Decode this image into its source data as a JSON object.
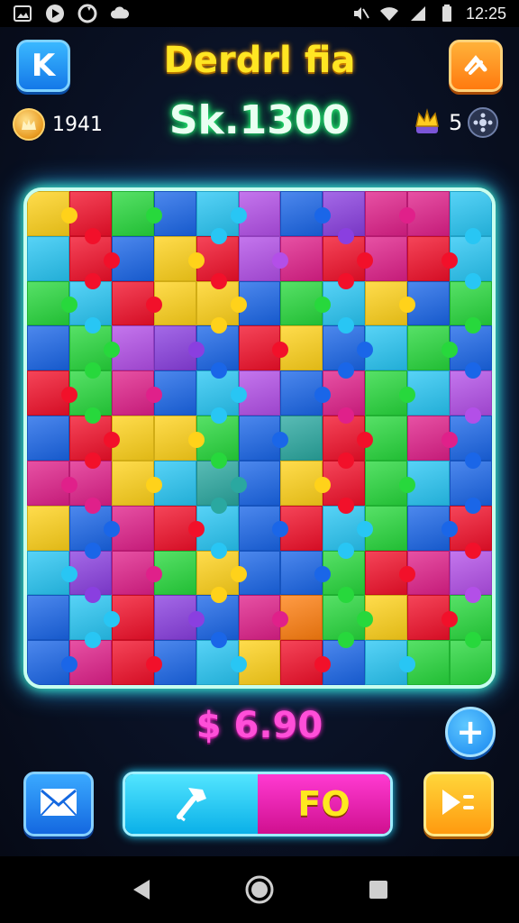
{
  "status_bar": {
    "time": "12:25",
    "left_icons": [
      "gallery-icon",
      "media-icon",
      "sync-icon",
      "cloud-icon"
    ],
    "right_icons": [
      "mute-icon",
      "wifi-icon",
      "signal-icon",
      "battery-icon"
    ]
  },
  "header": {
    "title": "Derdrl fia",
    "back_label": "K",
    "coins_value": "1941",
    "score": "Sk.1300",
    "crowns_value": "5"
  },
  "board": {
    "rows": 11,
    "cols": 11,
    "palette": {
      "r": "#f2102a",
      "o": "#ff7f10",
      "y": "#ffd21a",
      "g": "#27d83c",
      "c": "#28c6f4",
      "b": "#1a66e8",
      "p": "#8a3fe0",
      "m": "#e0208a",
      "t": "#2aa8a0",
      "v": "#b34fe8",
      "l": "#9be22a"
    },
    "tiles": [
      "yrgbcvbpmmc",
      "crbyrvmrmrc",
      "gcryybgcybg",
      "bgvpbrybcgb",
      "rgmbcvbmgcv",
      "bryygbtrgmb",
      "mmyctbyrgcb",
      "ybmrcbrcgbr",
      "cpmgybbgrmv",
      "bcrpbmogyrg",
      "bmrbcyrbcgg"
    ]
  },
  "price": "$ 6.90",
  "add_label": "+",
  "power_bar": {
    "right_label": "FO",
    "fill_fraction": 0.5,
    "left_color": "#22c8f4",
    "right_color": "#e81fb0"
  },
  "colors": {
    "title": "#ffe523",
    "score_glow": "#2dff7a",
    "price": "#ff4fd8",
    "board_glow": "#3dffbf"
  }
}
